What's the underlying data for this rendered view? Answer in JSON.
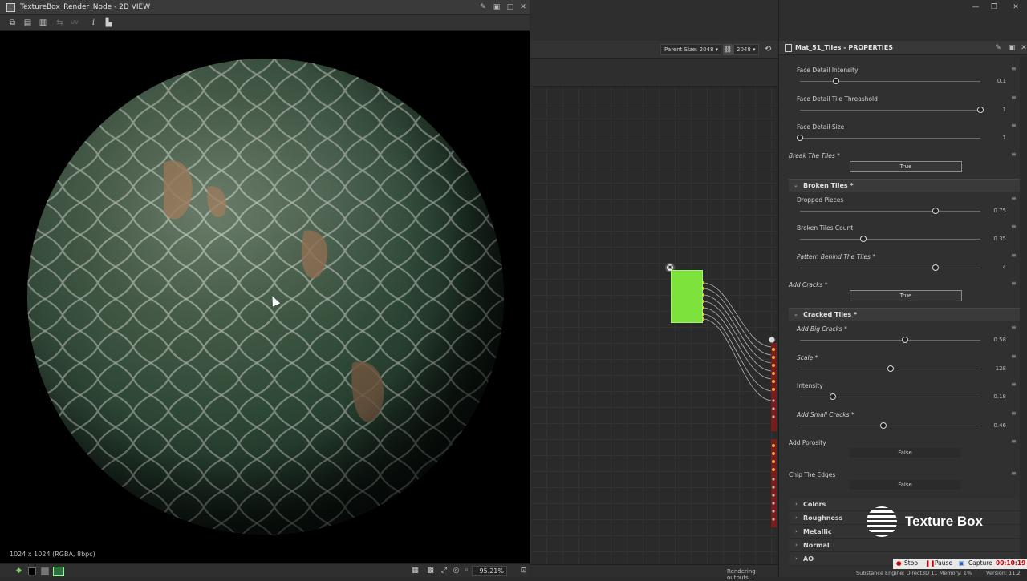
{
  "view2d": {
    "title": "TextureBox_Render_Node - 2D VIEW",
    "status_text": "1024 x 1024 (RGBA, 8bpc)",
    "zoom": "95.21%",
    "toolbar_icons": [
      "copy-icon",
      "save-icon",
      "save-copy-icon",
      "channels-icon",
      "uv-icon",
      "info-icon",
      "histogram-icon"
    ],
    "uv_label": "UV"
  },
  "graph": {
    "parent_size_label": "Parent Size:",
    "parent_size_value": "2048",
    "size_value": "2048",
    "render_status": "Rendering outputs..."
  },
  "props": {
    "title": "Mat_51_Tiles - PROPERTIES",
    "items": [
      {
        "type": "slider",
        "label": "Face Detail Intensity",
        "italic": false,
        "value": "0.1",
        "pos": 0.2
      },
      {
        "type": "slider",
        "label": "Face Detail Tile Threashold",
        "italic": false,
        "value": "1",
        "pos": 1.0
      },
      {
        "type": "slider",
        "label": "Face Detail Size",
        "italic": false,
        "value": "1",
        "pos": 0.0
      },
      {
        "type": "bool",
        "label": "Break The Tiles *",
        "value": "True"
      },
      {
        "type": "group",
        "label": "Broken Tiles *"
      },
      {
        "type": "slider",
        "label": "Dropped Pieces",
        "italic": false,
        "value": "0.75",
        "pos": 0.75
      },
      {
        "type": "slider",
        "label": "Broken Tiles Count",
        "italic": false,
        "value": "0.35",
        "pos": 0.35
      },
      {
        "type": "slider",
        "label": "Pattern Behind The Tiles *",
        "italic": true,
        "value": "4",
        "pos": 0.75
      },
      {
        "type": "bool",
        "label": "Add Cracks *",
        "value": "True"
      },
      {
        "type": "group",
        "label": "Cracked Tiles *"
      },
      {
        "type": "slider",
        "label": "Add Big Cracks *",
        "italic": true,
        "value": "0.58",
        "pos": 0.58
      },
      {
        "type": "slider",
        "label": "Scale *",
        "italic": true,
        "value": "128",
        "pos": 0.5
      },
      {
        "type": "slider",
        "label": "Intensity",
        "italic": false,
        "value": "0.18",
        "pos": 0.18
      },
      {
        "type": "slider",
        "label": "Add Small Cracks *",
        "italic": true,
        "value": "0.46",
        "pos": 0.46
      },
      {
        "type": "boolf",
        "label": "Add Porosity",
        "value": "False"
      },
      {
        "type": "boolf",
        "label": "Chip The Edges",
        "value": "False"
      }
    ],
    "sections": [
      "Colors",
      "Roughness",
      "Metallic",
      "Normal",
      "AO"
    ]
  },
  "watermark": {
    "text": "Texture Box"
  },
  "recorder": {
    "stop": "Stop",
    "pause": "Pause",
    "capture": "Capture",
    "time": "00:10:19"
  },
  "engine": {
    "text": "Substance Engine: Direct3D 11  Memory: 1%",
    "version": "Version: 11.2"
  }
}
